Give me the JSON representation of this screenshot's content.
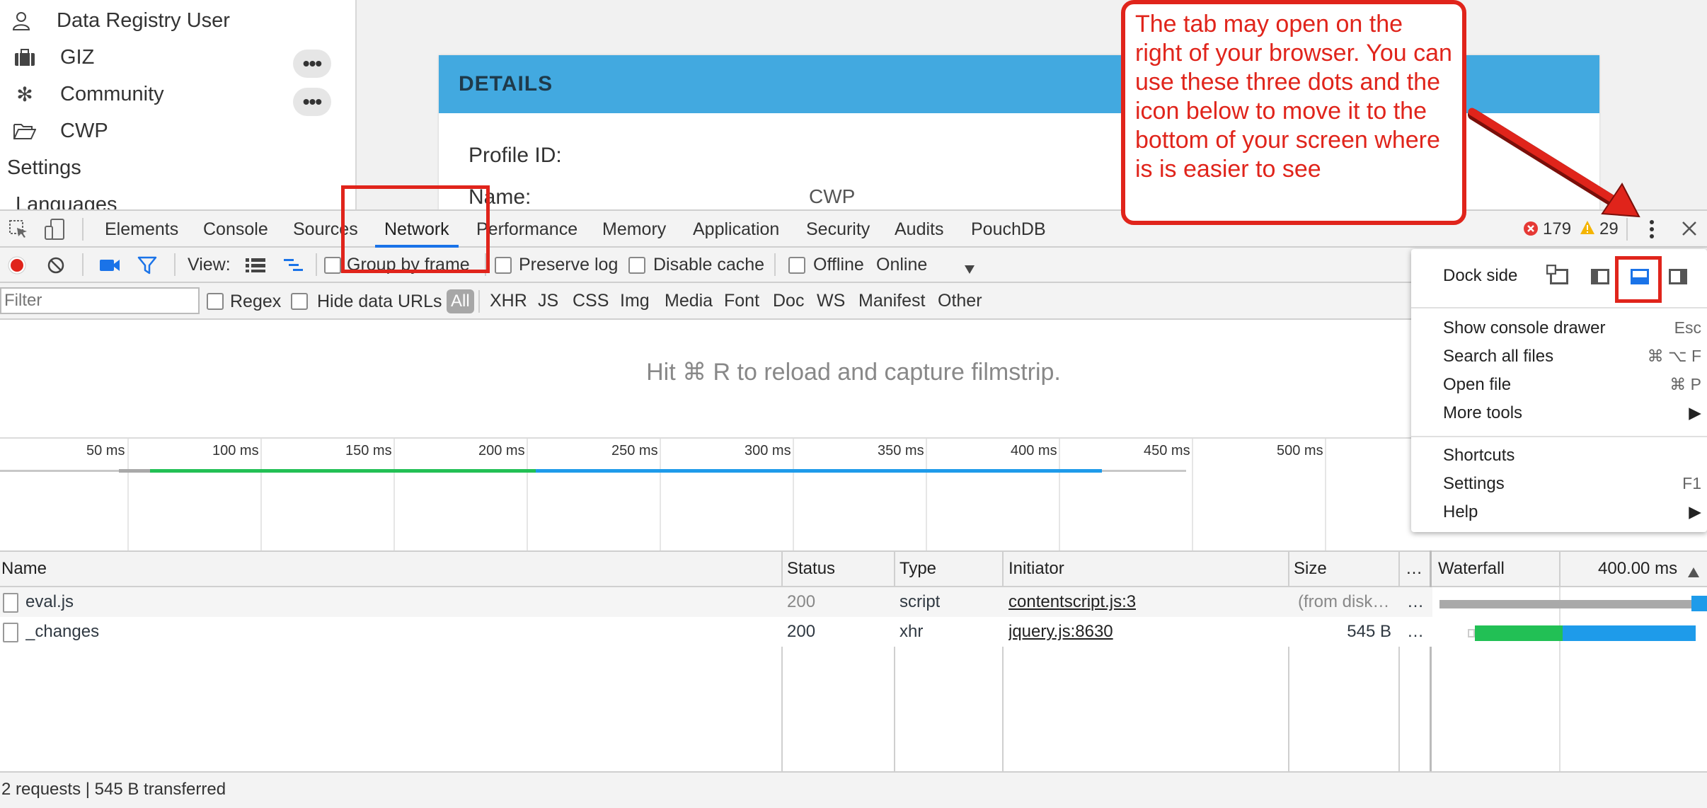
{
  "page": {
    "sidebar": {
      "items": [
        {
          "label": "Data Registry User",
          "icon": "user-icon"
        },
        {
          "label": "GIZ",
          "icon": "briefcase-icon"
        },
        {
          "label": "Community",
          "icon": "snowflake-icon"
        },
        {
          "label": "CWP",
          "icon": "folder-open-icon"
        }
      ],
      "more_label": "•••",
      "settings": "Settings",
      "languages": "Languages"
    },
    "details": {
      "header": "DETAILS",
      "profile_id_label": "Profile ID:",
      "name_label": "Name:",
      "name_value": "CWP"
    }
  },
  "devtools": {
    "tabs": [
      "Elements",
      "Console",
      "Sources",
      "Network",
      "Performance",
      "Memory",
      "Application",
      "Security",
      "Audits",
      "PouchDB"
    ],
    "active_tab": "Network",
    "errors": "179",
    "warnings": "29",
    "toolbar": {
      "view_label": "View:",
      "group_by_frame": "Group by frame",
      "preserve_log": "Preserve log",
      "disable_cache": "Disable cache",
      "offline": "Offline",
      "throttle": "Online"
    },
    "filter": {
      "placeholder": "Filter",
      "regex": "Regex",
      "hide_data_urls": "Hide data URLs",
      "types": [
        "All",
        "XHR",
        "JS",
        "CSS",
        "Img",
        "Media",
        "Font",
        "Doc",
        "WS",
        "Manifest",
        "Other"
      ]
    },
    "filmstrip_message": "Hit ⌘ R to reload and capture filmstrip.",
    "overview_ticks": [
      "50 ms",
      "100 ms",
      "150 ms",
      "200 ms",
      "250 ms",
      "300 ms",
      "350 ms",
      "400 ms",
      "450 ms",
      "500 ms"
    ],
    "columns": {
      "name": "Name",
      "status": "Status",
      "type": "Type",
      "initiator": "Initiator",
      "size": "Size",
      "more": "…",
      "waterfall": "Waterfall",
      "waterfall_time": "400.00 ms"
    },
    "requests": [
      {
        "name": "eval.js",
        "status": "200",
        "type": "script",
        "initiator": "contentscript.js:3",
        "size": "(from disk…",
        "more": "…"
      },
      {
        "name": "_changes",
        "status": "200",
        "type": "xhr",
        "initiator": "jquery.js:8630",
        "size": "545 B",
        "more": "…"
      }
    ],
    "status_bar": "2 requests | 545 B transferred"
  },
  "menu": {
    "dock_side": "Dock side",
    "items": [
      {
        "label": "Show console drawer",
        "shortcut": "Esc"
      },
      {
        "label": "Search all files",
        "shortcut": "⌘ ⌥ F"
      },
      {
        "label": "Open file",
        "shortcut": "⌘ P"
      },
      {
        "label": "More tools",
        "shortcut": "▶"
      },
      {
        "label": "Shortcuts",
        "shortcut": ""
      },
      {
        "label": "Settings",
        "shortcut": "F1"
      },
      {
        "label": "Help",
        "shortcut": "▶"
      }
    ]
  },
  "annotation": {
    "callout": "The tab may open on the right of your browser.  You can use these three dots and the icon below to move it to the bottom of your screen where is is easier to see"
  },
  "colors": {
    "accent": "#1a73e8",
    "details_header": "#42a9e0",
    "annotation_red": "#e0241b",
    "waterfall_green": "#22c055",
    "waterfall_blue": "#1e9bea",
    "waterfall_gray": "#a9a9a9"
  }
}
